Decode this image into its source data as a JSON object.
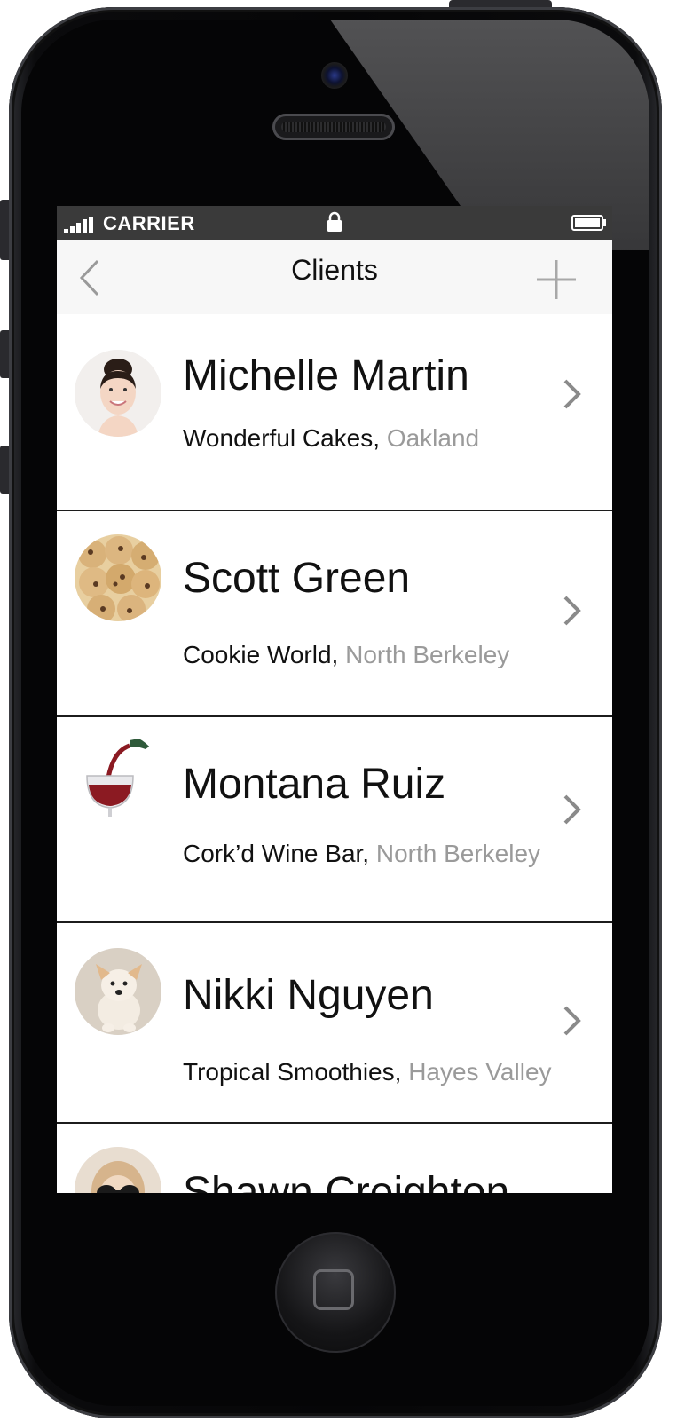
{
  "status_bar": {
    "carrier": "CARRIER"
  },
  "nav": {
    "title": "Clients",
    "back_icon": "chevron-left-icon",
    "add_icon": "plus-icon"
  },
  "clients": [
    {
      "name": "Michelle Martin",
      "company": "Wonderful Cakes,",
      "location": "Oakland",
      "avatar": "woman-portrait"
    },
    {
      "name": "Scott Green",
      "company": "Cookie World,",
      "location": "North Berkeley",
      "avatar": "cookies"
    },
    {
      "name": "Montana Ruiz",
      "company": "Cork’d Wine Bar,",
      "location": "North Berkeley",
      "avatar": "wine-glass"
    },
    {
      "name": "Nikki Nguyen",
      "company": "Tropical Smoothies,",
      "location": "Hayes Valley",
      "avatar": "puppy"
    },
    {
      "name": "Shawn Creighton",
      "company": "",
      "location": "",
      "avatar": "sunglasses-person"
    }
  ],
  "colors": {
    "status_bar_bg": "#3a3a3a",
    "nav_bg": "#f7f7f7",
    "location_text": "#9a9a9a",
    "divider": "#1c1c1c"
  }
}
